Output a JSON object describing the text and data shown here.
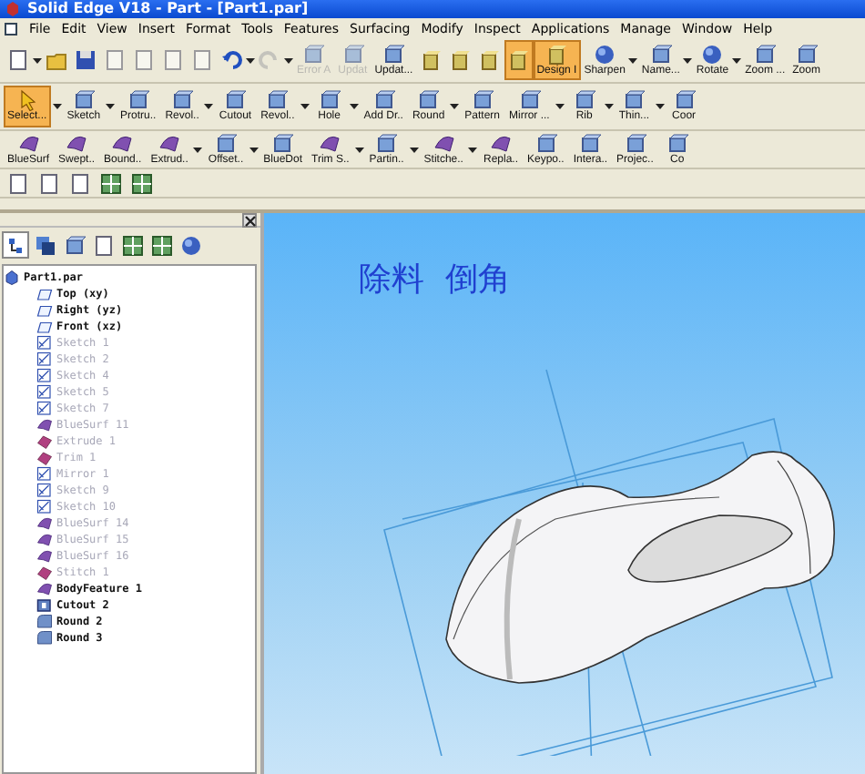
{
  "window": {
    "title": "Solid Edge V18 - Part - [Part1.par]"
  },
  "menu": [
    "File",
    "Edit",
    "View",
    "Insert",
    "Format",
    "Tools",
    "Features",
    "Surfacing",
    "Modify",
    "Inspect",
    "Applications",
    "Manage",
    "Window",
    "Help"
  ],
  "toolbars": [
    {
      "buttons": [
        {
          "kind": "doc",
          "has_menu": true,
          "disabled": false,
          "selected": false
        },
        {
          "kind": "folder",
          "has_menu": false,
          "disabled": false,
          "selected": false
        },
        {
          "kind": "disk",
          "has_menu": false,
          "disabled": false,
          "selected": false
        },
        {
          "kind": "doc",
          "has_menu": false,
          "disabled": true,
          "selected": false
        },
        {
          "kind": "doc",
          "has_menu": false,
          "disabled": true,
          "selected": false
        },
        {
          "kind": "doc",
          "has_menu": false,
          "disabled": true,
          "selected": false
        },
        {
          "kind": "doc",
          "has_menu": false,
          "disabled": true,
          "selected": false
        },
        {
          "kind": "undo",
          "has_menu": true,
          "disabled": false,
          "selected": false
        },
        {
          "kind": "redo",
          "has_menu": true,
          "disabled": true,
          "selected": false
        },
        {
          "label": "Error A",
          "kind": "feature",
          "has_menu": false,
          "disabled": true,
          "selected": false
        },
        {
          "label": "Updat",
          "kind": "feature",
          "has_menu": false,
          "disabled": true,
          "selected": false
        },
        {
          "label": "Updat...",
          "kind": "feature",
          "has_menu": false,
          "disabled": false,
          "selected": false
        },
        {
          "kind": "cube",
          "has_menu": false,
          "disabled": false,
          "selected": false
        },
        {
          "kind": "cube",
          "has_menu": false,
          "disabled": false,
          "selected": false
        },
        {
          "kind": "cube",
          "has_menu": false,
          "disabled": false,
          "selected": false
        },
        {
          "kind": "cube",
          "has_menu": false,
          "disabled": false,
          "selected": true
        },
        {
          "label": "Design I",
          "kind": "cube",
          "has_menu": false,
          "disabled": false,
          "selected": true
        },
        {
          "label": "Sharpen",
          "kind": "sphere",
          "has_menu": true,
          "disabled": false,
          "selected": false
        },
        {
          "label": "Name...",
          "kind": "feature",
          "has_menu": true,
          "disabled": false,
          "selected": false
        },
        {
          "label": "Rotate",
          "kind": "sphere",
          "has_menu": true,
          "disabled": false,
          "selected": false
        },
        {
          "label": "Zoom ...",
          "kind": "feature",
          "has_menu": false,
          "disabled": false,
          "selected": false
        },
        {
          "label": "Zoom",
          "kind": "feature",
          "has_menu": false,
          "disabled": false,
          "selected": false
        }
      ]
    },
    {
      "buttons": [
        {
          "label": "Select...",
          "kind": "arrow",
          "has_menu": true,
          "disabled": false,
          "selected": true
        },
        {
          "label": "Sketch",
          "kind": "feature",
          "has_menu": true,
          "disabled": false,
          "selected": false
        },
        {
          "label": "Protru..",
          "kind": "feature",
          "has_menu": false,
          "disabled": false,
          "selected": false
        },
        {
          "label": "Revol..",
          "kind": "feature",
          "has_menu": true,
          "disabled": false,
          "selected": false
        },
        {
          "label": "Cutout",
          "kind": "feature",
          "has_menu": false,
          "disabled": false,
          "selected": false
        },
        {
          "label": "Revol..",
          "kind": "feature",
          "has_menu": true,
          "disabled": false,
          "selected": false
        },
        {
          "label": "Hole",
          "kind": "feature",
          "has_menu": true,
          "disabled": false,
          "selected": false
        },
        {
          "label": "Add Dr..",
          "kind": "feature",
          "has_menu": false,
          "disabled": false,
          "selected": false
        },
        {
          "label": "Round",
          "kind": "feature",
          "has_menu": true,
          "disabled": false,
          "selected": false
        },
        {
          "label": "Pattern",
          "kind": "feature",
          "has_menu": false,
          "disabled": false,
          "selected": false
        },
        {
          "label": "Mirror ...",
          "kind": "feature",
          "has_menu": true,
          "disabled": false,
          "selected": false
        },
        {
          "label": "Rib",
          "kind": "feature",
          "has_menu": true,
          "disabled": false,
          "selected": false
        },
        {
          "label": "Thin...",
          "kind": "feature",
          "has_menu": true,
          "disabled": false,
          "selected": false
        },
        {
          "label": "Coor",
          "kind": "feature",
          "has_menu": false,
          "disabled": false,
          "selected": false
        }
      ]
    },
    {
      "buttons": [
        {
          "label": "BlueSurf",
          "kind": "surface",
          "has_menu": false,
          "disabled": false,
          "selected": false
        },
        {
          "label": "Swept..",
          "kind": "surface",
          "has_menu": false,
          "disabled": false,
          "selected": false
        },
        {
          "label": "Bound..",
          "kind": "surface",
          "has_menu": false,
          "disabled": false,
          "selected": false
        },
        {
          "label": "Extrud..",
          "kind": "surface",
          "has_menu": true,
          "disabled": false,
          "selected": false
        },
        {
          "label": "Offset..",
          "kind": "feature",
          "has_menu": true,
          "disabled": false,
          "selected": false
        },
        {
          "label": "BlueDot",
          "kind": "feature",
          "has_menu": false,
          "disabled": false,
          "selected": false
        },
        {
          "label": "Trim S..",
          "kind": "surface",
          "has_menu": true,
          "disabled": false,
          "selected": false
        },
        {
          "label": "Partin..",
          "kind": "feature",
          "has_menu": true,
          "disabled": false,
          "selected": false
        },
        {
          "label": "Stitche..",
          "kind": "surface",
          "has_menu": true,
          "disabled": false,
          "selected": false
        },
        {
          "label": "Repla..",
          "kind": "surface",
          "has_menu": false,
          "disabled": false,
          "selected": false
        },
        {
          "label": "Keypo..",
          "kind": "feature",
          "has_menu": false,
          "disabled": false,
          "selected": false
        },
        {
          "label": "Intera..",
          "kind": "feature",
          "has_menu": false,
          "disabled": false,
          "selected": false
        },
        {
          "label": "Projec..",
          "kind": "feature",
          "has_menu": false,
          "disabled": false,
          "selected": false
        },
        {
          "label": "Co",
          "kind": "feature",
          "has_menu": false,
          "disabled": false,
          "selected": false
        }
      ]
    }
  ],
  "pathfinder": {
    "tabs": [
      {
        "kind": "tree",
        "selected": true
      },
      {
        "kind": "layers",
        "selected": false
      },
      {
        "kind": "feature",
        "selected": false
      },
      {
        "kind": "doc",
        "selected": false
      },
      {
        "kind": "grid",
        "selected": false
      },
      {
        "kind": "grid",
        "selected": false
      },
      {
        "kind": "sphere",
        "selected": false
      }
    ],
    "tree": {
      "label": "Part1.par",
      "kind": "part",
      "dimmed": false,
      "children": [
        {
          "label": "Top (xy)",
          "kind": "plane",
          "dimmed": false
        },
        {
          "label": "Right (yz)",
          "kind": "plane",
          "dimmed": false
        },
        {
          "label": "Front (xz)",
          "kind": "plane",
          "dimmed": false
        },
        {
          "label": "Sketch 1",
          "kind": "sketch",
          "dimmed": true
        },
        {
          "label": "Sketch 2",
          "kind": "sketch",
          "dimmed": true
        },
        {
          "label": "Sketch 4",
          "kind": "sketch",
          "dimmed": true
        },
        {
          "label": "Sketch 5",
          "kind": "sketch",
          "dimmed": true
        },
        {
          "label": "Sketch 7",
          "kind": "sketch",
          "dimmed": true
        },
        {
          "label": "BlueSurf 11",
          "kind": "surface",
          "dimmed": true
        },
        {
          "label": "Extrude 1",
          "kind": "extrude",
          "dimmed": true
        },
        {
          "label": "Trim 1",
          "kind": "extrude",
          "dimmed": true
        },
        {
          "label": "Mirror 1",
          "kind": "sketch",
          "dimmed": true
        },
        {
          "label": "Sketch 9",
          "kind": "sketch",
          "dimmed": true
        },
        {
          "label": "Sketch 10",
          "kind": "sketch",
          "dimmed": true
        },
        {
          "label": "BlueSurf 14",
          "kind": "surface",
          "dimmed": true
        },
        {
          "label": "BlueSurf 15",
          "kind": "surface",
          "dimmed": true
        },
        {
          "label": "BlueSurf 16",
          "kind": "surface",
          "dimmed": true
        },
        {
          "label": "Stitch 1",
          "kind": "extrude",
          "dimmed": true
        },
        {
          "label": "BodyFeature 1",
          "kind": "surface",
          "dimmed": false
        },
        {
          "label": "Cutout 2",
          "kind": "cutout",
          "dimmed": false
        },
        {
          "label": "Round 2",
          "kind": "round",
          "dimmed": false
        },
        {
          "label": "Round 3",
          "kind": "round",
          "dimmed": false
        }
      ]
    }
  },
  "viewport": {
    "caption": "除料  倒角"
  }
}
